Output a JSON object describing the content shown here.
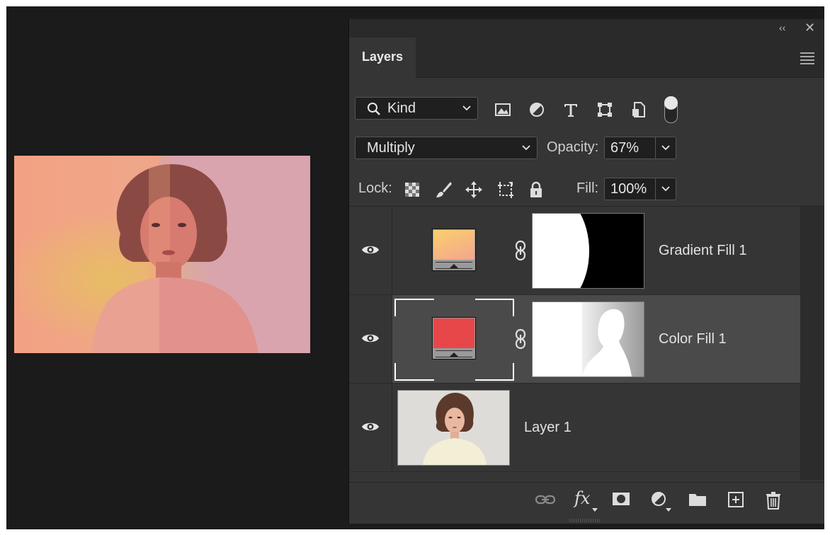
{
  "panel": {
    "collapse_glyph": "‹‹",
    "close_glyph": "✕",
    "tab_label": "Layers",
    "filter": {
      "kind_label": "Kind",
      "icons": [
        "image-filter-icon",
        "adjustment-filter-icon",
        "type-filter-icon",
        "shape-filter-icon",
        "smart-object-filter-icon"
      ],
      "toggle": "on"
    },
    "blend_mode": "Multiply",
    "opacity_label": "Opacity:",
    "opacity_value": "67%",
    "lock_label": "Lock:",
    "fill_label": "Fill:",
    "fill_value": "100%"
  },
  "layers": [
    {
      "name": "Gradient Fill 1",
      "visible": true,
      "swatch_colors": [
        "#f8c96e",
        "#f6a98b"
      ],
      "selected": false
    },
    {
      "name": "Color Fill 1",
      "visible": true,
      "swatch_colors": [
        "#e8474a"
      ],
      "selected": true
    },
    {
      "name": "Layer 1",
      "visible": true,
      "selected": false
    }
  ],
  "bottom_icons": [
    "link-layers-icon",
    "fx-icon",
    "mask-icon",
    "adjustment-layer-icon",
    "group-folder-icon",
    "new-layer-icon",
    "delete-icon"
  ],
  "fx_label": "fx",
  "colors": {
    "panel_bg": "#353535",
    "canvas_bg": "#1b1b1b",
    "selected_row": "#4a4a4a",
    "color_fill": "#e8474a"
  }
}
